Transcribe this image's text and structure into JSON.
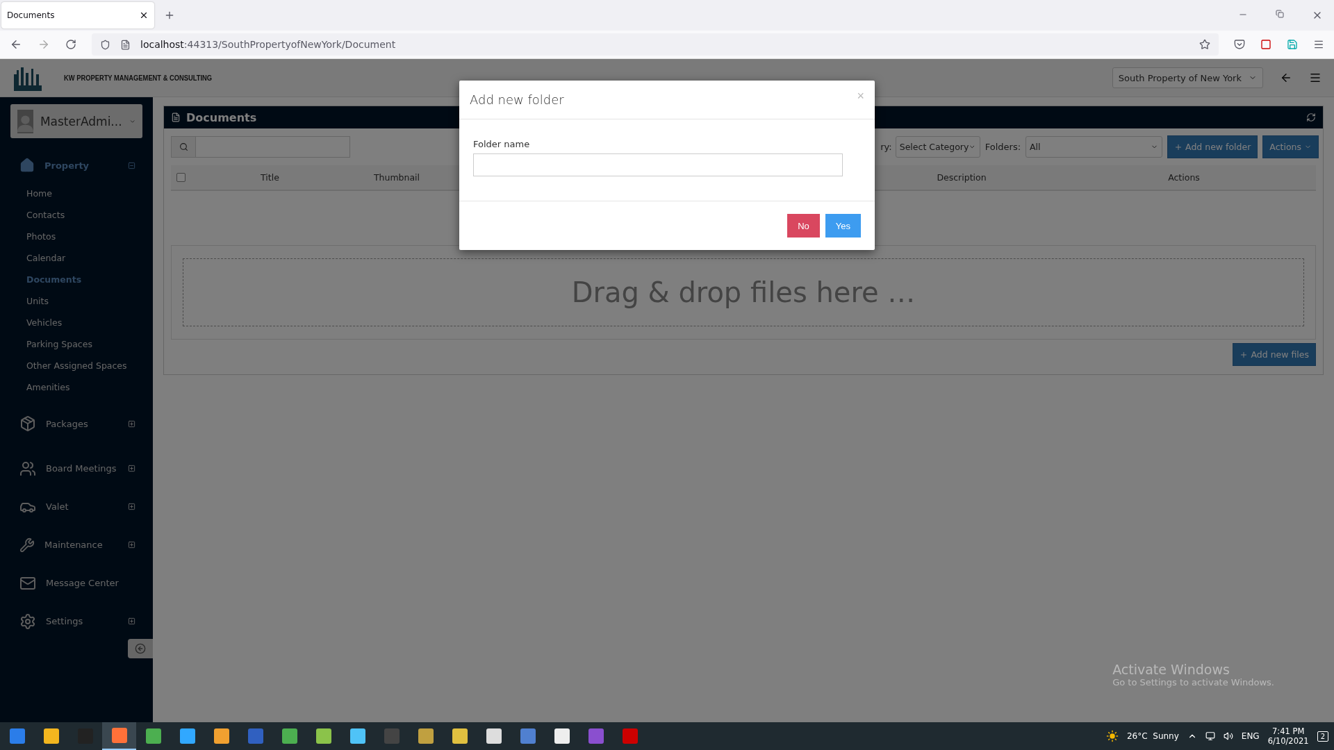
{
  "browser": {
    "tab_title": "Documents",
    "url_host": "localhost",
    "url_rest": ":44313/SouthPropertyofNewYork/Document"
  },
  "header": {
    "brand": "KW PROPERTY MANAGEMENT & CONSULTING",
    "property_select": "South Property of New York"
  },
  "sidebar": {
    "user": "MasterAdmi...",
    "sections": [
      {
        "label": "Property",
        "expanded": true,
        "selected": true,
        "children": [
          {
            "label": "Home",
            "selected": false
          },
          {
            "label": "Contacts",
            "selected": false
          },
          {
            "label": "Photos",
            "selected": false
          },
          {
            "label": "Calendar",
            "selected": false
          },
          {
            "label": "Documents",
            "selected": true
          },
          {
            "label": "Units",
            "selected": false
          },
          {
            "label": "Vehicles",
            "selected": false
          },
          {
            "label": "Parking Spaces",
            "selected": false
          },
          {
            "label": "Other Assigned Spaces",
            "selected": false
          },
          {
            "label": "Amenities",
            "selected": false
          }
        ]
      },
      {
        "label": "Packages",
        "expanded": false,
        "selected": false
      },
      {
        "label": "Board Meetings",
        "expanded": false,
        "selected": false
      },
      {
        "label": "Valet",
        "expanded": false,
        "selected": false
      },
      {
        "label": "Maintenance",
        "expanded": false,
        "selected": false
      },
      {
        "label": "Message Center",
        "selected": false
      },
      {
        "label": "Settings",
        "expanded": false,
        "selected": false
      }
    ]
  },
  "panel": {
    "title": "Documents",
    "category_label": "ry:",
    "category_select": "Select Category",
    "folders_label": "Folders:",
    "folders_select": "All",
    "add_folder_button": "Add new folder",
    "actions_button": "Actions",
    "select_all_checked": false,
    "columns": [
      "Title",
      "Thumbnail",
      "Description",
      "Actions"
    ],
    "dropzone": "Drag & drop files here …",
    "add_files_button": "Add new files"
  },
  "dialog": {
    "title": "Add new folder",
    "close": "×",
    "field_label": "Folder name",
    "buttons": [
      {
        "label": "No",
        "kind": "danger"
      },
      {
        "label": "Yes",
        "kind": "primary"
      }
    ]
  },
  "watermark": {
    "title": "Activate Windows",
    "subtitle": "Go to Settings to activate Windows."
  },
  "taskbar": {
    "weather": "26°C  Sunny",
    "language": "ENG",
    "time": "7:41 PM",
    "date": "6/10/2021",
    "notifications": "2"
  }
}
